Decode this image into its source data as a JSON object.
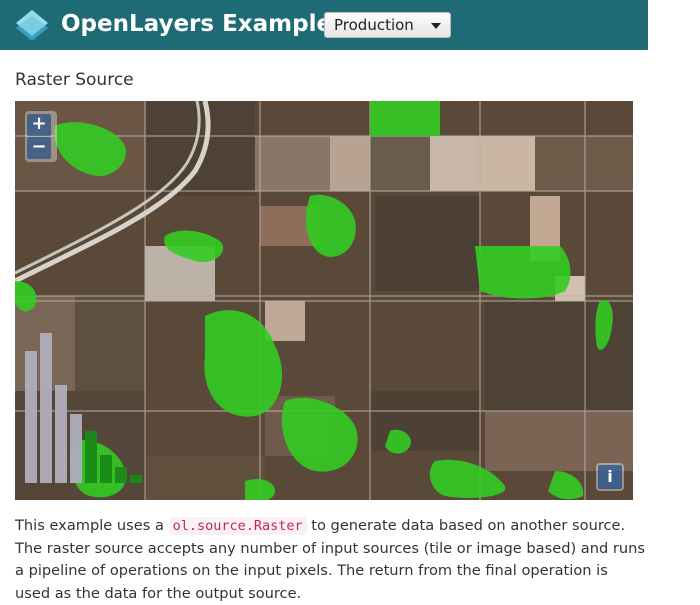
{
  "header": {
    "brand": "OpenLayers Examples",
    "version_selected": "Production",
    "logo_icon": "openlayers-logo-icon"
  },
  "page": {
    "title": "Raster Source"
  },
  "map": {
    "zoom_in_label": "+",
    "zoom_out_label": "−",
    "info_label": "i",
    "colors": {
      "vegetation_green": "#33cc22",
      "histogram_bar_gray": "#aeaebb",
      "histogram_bar_green": "#1a8a1a"
    }
  },
  "description": {
    "before": "This example uses a ",
    "code": "ol.source.Raster",
    "after": " to generate data based on another source. The raster source accepts any number of input sources (tile or image based) and runs a pipeline of operations on the input pixels. The return from the final operation is used as the data for the output source."
  }
}
